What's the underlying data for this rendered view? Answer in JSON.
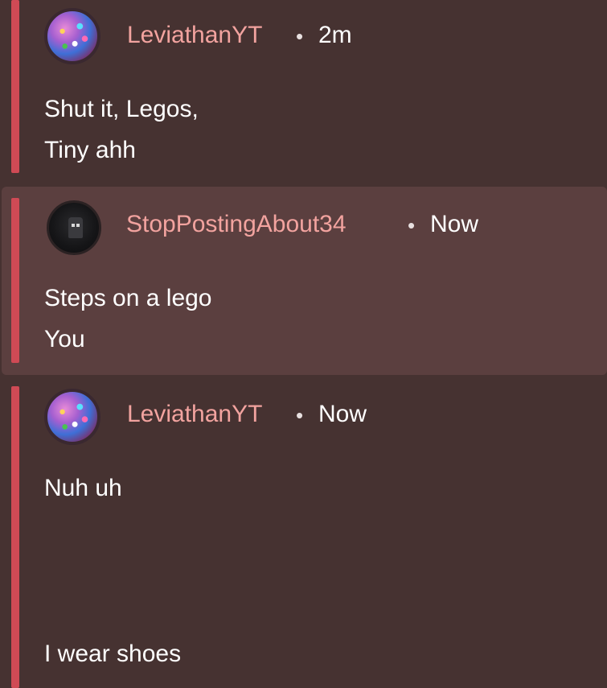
{
  "comments": [
    {
      "username": "LeviathanYT",
      "separator": "•",
      "time": "2m",
      "avatar": "leviathan-avatar",
      "lines": [
        "Shut it, Legos,",
        "Tiny ahh"
      ]
    },
    {
      "username": "StopPostingAbout34",
      "separator": "•",
      "time": "Now",
      "avatar": "dark-figure-avatar",
      "lines": [
        "Steps on a lego",
        "You"
      ]
    },
    {
      "username": "LeviathanYT",
      "separator": "•",
      "time": "Now",
      "avatar": "leviathan-avatar",
      "lines": [
        "Nuh uh",
        "I wear shoes"
      ]
    }
  ],
  "colors": {
    "background": "#463231",
    "highlight": "#5b3f3f",
    "thread_bar": "#cf4a55",
    "username": "#f2a39f",
    "text": "#ffffff"
  }
}
